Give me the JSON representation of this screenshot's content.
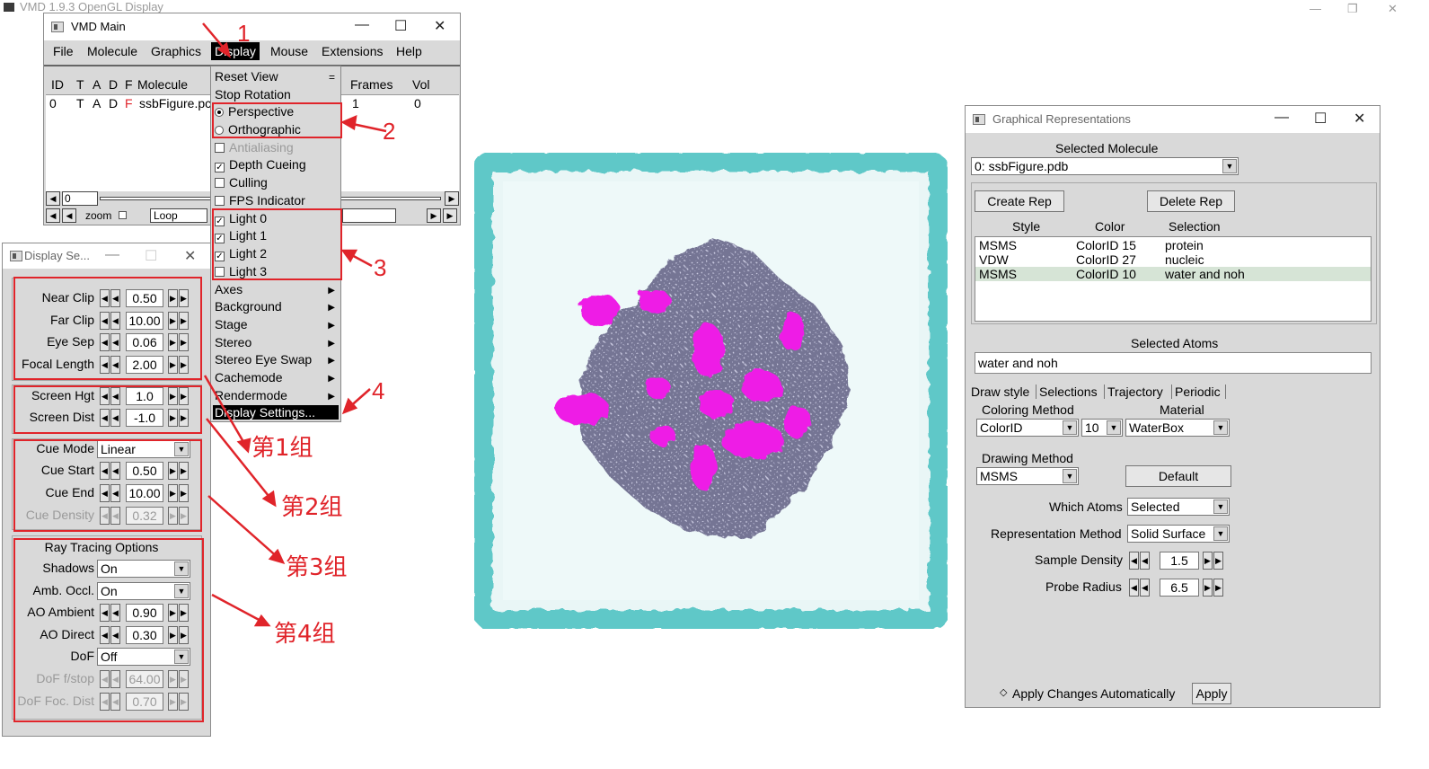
{
  "background_window": {
    "title": "VMD 1.9.3 OpenGL Display"
  },
  "vmd_main": {
    "title": "VMD Main",
    "menu": [
      "File",
      "Molecule",
      "Graphics",
      "Display",
      "Mouse",
      "Extensions",
      "Help"
    ],
    "columns": [
      "ID",
      "T",
      "A",
      "D",
      "F",
      "Molecule",
      "Frames",
      "Vol"
    ],
    "row": {
      "id": "0",
      "t": "T",
      "a": "A",
      "d": "D",
      "f": "F",
      "molecule": "ssbFigure.pc",
      "frames": "1",
      "vol": "0"
    },
    "frame_value": "0",
    "zoom_label": "zoom",
    "loop_value": "Loop"
  },
  "display_menu": {
    "reset_view": "Reset View",
    "reset_view_tearoff": "=",
    "stop_rotation": "Stop Rotation",
    "perspective": "Perspective",
    "orthographic": "Orthographic",
    "antialiasing": "Antialiasing",
    "depth_cueing": "Depth Cueing",
    "culling": "Culling",
    "fps_indicator": "FPS Indicator",
    "light0": "Light 0",
    "light1": "Light 1",
    "light2": "Light 2",
    "light3": "Light 3",
    "axes": "Axes",
    "background": "Background",
    "stage": "Stage",
    "stereo": "Stereo",
    "stereo_eye_swap": "Stereo Eye Swap",
    "cachemode": "Cachemode",
    "rendermode": "Rendermode",
    "display_settings": "Display Settings..."
  },
  "annotations": {
    "n1": "1",
    "n2": "2",
    "n3": "3",
    "n4": "4",
    "group1": "第1组",
    "group2": "第2组",
    "group3": "第3组",
    "group4": "第4组"
  },
  "display_settings": {
    "title": "Display Se...",
    "near_clip": {
      "label": "Near Clip",
      "value": "0.50"
    },
    "far_clip": {
      "label": "Far Clip",
      "value": "10.00"
    },
    "eye_sep": {
      "label": "Eye Sep",
      "value": "0.06"
    },
    "focal_length": {
      "label": "Focal Length",
      "value": "2.00"
    },
    "screen_hgt": {
      "label": "Screen Hgt",
      "value": "1.0"
    },
    "screen_dist": {
      "label": "Screen Dist",
      "value": "-1.0"
    },
    "cue_mode": {
      "label": "Cue Mode",
      "value": "Linear"
    },
    "cue_start": {
      "label": "Cue Start",
      "value": "0.50"
    },
    "cue_end": {
      "label": "Cue End",
      "value": "10.00"
    },
    "cue_density": {
      "label": "Cue Density",
      "value": "0.32"
    },
    "ray_tracing_title": "Ray Tracing Options",
    "shadows": {
      "label": "Shadows",
      "value": "On"
    },
    "amb_occl": {
      "label": "Amb. Occl.",
      "value": "On"
    },
    "ao_ambient": {
      "label": "AO Ambient",
      "value": "0.90"
    },
    "ao_direct": {
      "label": "AO Direct",
      "value": "0.30"
    },
    "dof": {
      "label": "DoF",
      "value": "Off"
    },
    "dof_fstop": {
      "label": "DoF f/stop",
      "value": "64.00"
    },
    "dof_foc_dist": {
      "label": "DoF Foc. Dist",
      "value": "0.70"
    }
  },
  "graphical_reps": {
    "title": "Graphical Representations",
    "selected_molecule_label": "Selected Molecule",
    "selected_molecule": "0: ssbFigure.pdb",
    "create_rep": "Create Rep",
    "delete_rep": "Delete Rep",
    "cols": [
      "Style",
      "Color",
      "Selection"
    ],
    "reps": [
      {
        "style": "MSMS",
        "color": "ColorID 15",
        "selection": "protein"
      },
      {
        "style": "VDW",
        "color": "ColorID 27",
        "selection": "nucleic"
      },
      {
        "style": "MSMS",
        "color": "ColorID 10",
        "selection": "water and noh"
      }
    ],
    "selected_atoms_label": "Selected Atoms",
    "selected_atoms": "water and noh",
    "tabs": [
      "Draw style",
      "Selections",
      "Trajectory",
      "Periodic"
    ],
    "coloring_method_label": "Coloring Method",
    "coloring_method": "ColorID",
    "color_id": "10",
    "material_label": "Material",
    "material": "WaterBox",
    "drawing_method_label": "Drawing Method",
    "drawing_method": "MSMS",
    "default_btn": "Default",
    "which_atoms_label": "Which Atoms",
    "which_atoms": "Selected",
    "rep_method_label": "Representation Method",
    "rep_method": "Solid Surface",
    "sample_density_label": "Sample Density",
    "sample_density": "1.5",
    "probe_radius_label": "Probe Radius",
    "probe_radius": "6.5",
    "apply_auto": "Apply Changes Automatically",
    "apply": "Apply"
  },
  "colors": {
    "annotation_red": "#e0242a",
    "water_box": "#5fc8c8",
    "protein": "#7a7a9c",
    "nucleic": "#ee1ee6"
  }
}
